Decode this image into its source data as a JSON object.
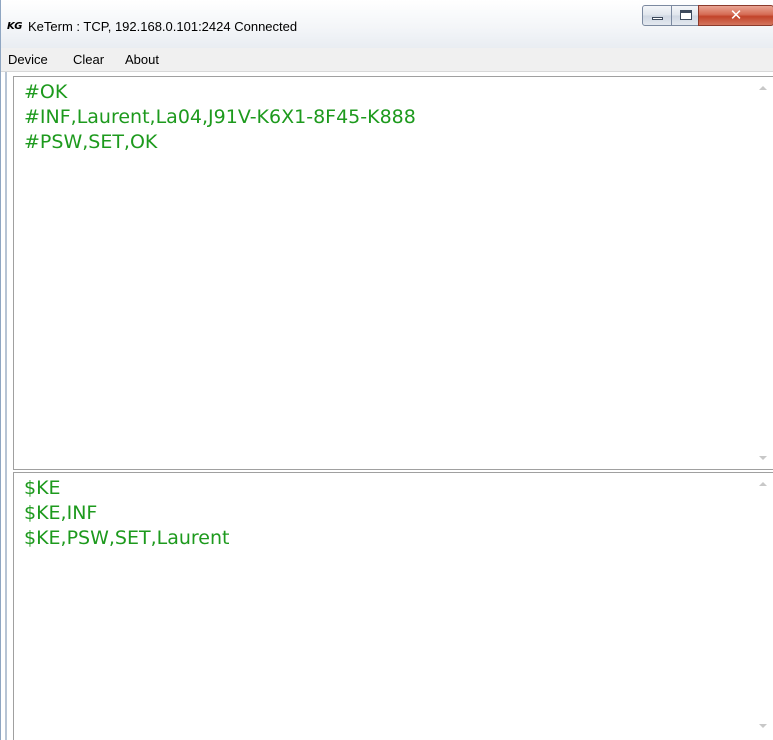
{
  "window": {
    "icon_text": "KG",
    "title": "KeTerm : TCP, 192.168.0.101:2424 Connected"
  },
  "menu": [
    {
      "label": "Device"
    },
    {
      "label": "Clear"
    },
    {
      "label": "About"
    }
  ],
  "received_pane": {
    "lines": [
      "#OK",
      "#INF,Laurent,La04,J91V-K6X1-8F45-K888",
      "#PSW,SET,OK"
    ]
  },
  "sent_pane": {
    "lines": [
      "$KE",
      "$KE,INF",
      "$KE,PSW,SET,Laurent"
    ]
  },
  "colors": {
    "text_green": "#1d9a1d",
    "close_button_red": "#c2432a"
  },
  "icons": {
    "minimize": "minimize-icon",
    "maximize": "maximize-icon",
    "close": "close-icon",
    "scroll_up": "arrow-up-icon",
    "scroll_down": "arrow-down-icon"
  }
}
